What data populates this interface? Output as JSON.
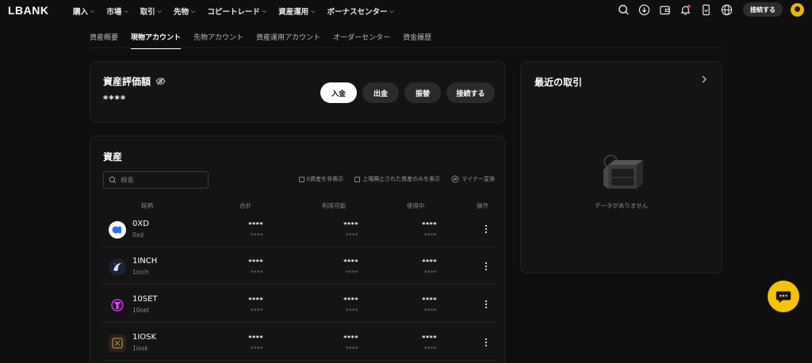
{
  "brand": {
    "logo": "LBANK",
    "accent": "#f5c400"
  },
  "nav": {
    "menu": [
      {
        "label": "購入",
        "icon": "chevron-down-icon"
      },
      {
        "label": "市場",
        "icon": "chevron-down-icon"
      },
      {
        "label": "取引",
        "icon": "chevron-down-icon"
      },
      {
        "label": "先物",
        "icon": "chevron-down-icon"
      },
      {
        "label": "コピートレード",
        "icon": "chevron-down-icon"
      },
      {
        "label": "資産運用",
        "icon": "chevron-down-icon"
      },
      {
        "label": "ボーナスセンター",
        "icon": "chevron-down-icon"
      }
    ],
    "icons": [
      "search-icon",
      "download-icon",
      "wallet-icon",
      "bell-icon",
      "mobile-icon",
      "globe-icon"
    ],
    "connect_label": "接続する"
  },
  "subtabs": [
    {
      "label": "資産概要",
      "active": false
    },
    {
      "label": "現物アカウント",
      "active": true
    },
    {
      "label": "先物アカウント",
      "active": false
    },
    {
      "label": "資産運用アカウント",
      "active": false
    },
    {
      "label": "オーダーセンター",
      "active": false
    },
    {
      "label": "資金履歴",
      "active": false
    }
  ],
  "balance": {
    "title": "資産評価額",
    "value": "****",
    "buttons": {
      "deposit": "入金",
      "withdraw": "出金",
      "transfer": "振替",
      "connect": "接続する"
    }
  },
  "assets": {
    "title": "資産",
    "search_placeholder": "検索",
    "filters": {
      "hide_zero": "0資産を非表示",
      "delisted_only": "上場廃止された資産のみを表示",
      "convert": "マイナー変換"
    },
    "columns": {
      "name": "銘柄",
      "total": "合計",
      "available": "利用可能",
      "in_use": "使用中",
      "action": "操作"
    },
    "rows": [
      {
        "symbol": "0XD",
        "name": "0xd",
        "total": "****",
        "total_sub": "****",
        "available": "****",
        "available_sub": "****",
        "in_use": "****",
        "in_use_sub": "****"
      },
      {
        "symbol": "1INCH",
        "name": "1inch",
        "total": "****",
        "total_sub": "****",
        "available": "****",
        "available_sub": "****",
        "in_use": "****",
        "in_use_sub": "****"
      },
      {
        "symbol": "10SET",
        "name": "10set",
        "total": "****",
        "total_sub": "****",
        "available": "****",
        "available_sub": "****",
        "in_use": "****",
        "in_use_sub": "****"
      },
      {
        "symbol": "1IOSK",
        "name": "1iosk",
        "total": "****",
        "total_sub": "****",
        "available": "****",
        "available_sub": "****",
        "in_use": "****",
        "in_use_sub": "****"
      }
    ]
  },
  "recent": {
    "title": "最近の取引",
    "empty_text": "データがありません"
  }
}
